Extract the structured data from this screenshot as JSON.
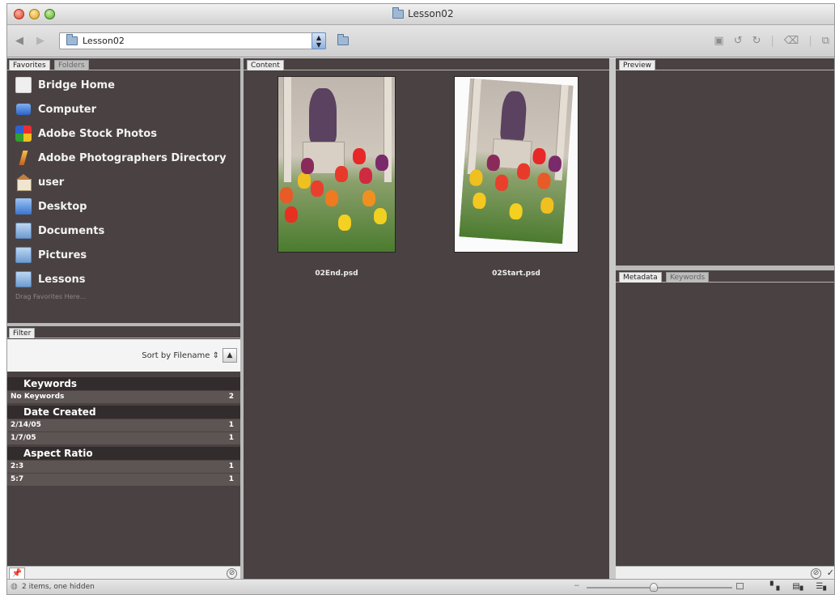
{
  "window": {
    "title": "Lesson02"
  },
  "toolbar": {
    "back_icon": "back-arrow-icon",
    "forward_icon": "forward-arrow-icon",
    "path_value": "Lesson02"
  },
  "favorites_panel": {
    "tabs": [
      "Favorites",
      "Folders"
    ],
    "items": [
      {
        "label": "Bridge Home",
        "icon": "bridge-home-icon"
      },
      {
        "label": "Computer",
        "icon": "computer-icon"
      },
      {
        "label": "Adobe Stock Photos",
        "icon": "stock-photos-icon"
      },
      {
        "label": "Adobe Photographers Directory",
        "icon": "photographers-icon"
      },
      {
        "label": "user",
        "icon": "home-icon"
      },
      {
        "label": "Desktop",
        "icon": "desktop-icon"
      },
      {
        "label": "Documents",
        "icon": "folder-icon"
      },
      {
        "label": "Pictures",
        "icon": "folder-icon"
      },
      {
        "label": "Lessons",
        "icon": "folder-icon"
      }
    ],
    "drag_hint": "Drag Favorites Here..."
  },
  "filter_panel": {
    "tab": "Filter",
    "sort_label": "Sort by Filename",
    "groups": [
      {
        "heading": "Keywords",
        "rows": [
          {
            "label": "No Keywords",
            "count": "2"
          }
        ]
      },
      {
        "heading": "Date Created",
        "rows": [
          {
            "label": "2/14/05",
            "count": "1"
          },
          {
            "label": "1/7/05",
            "count": "1"
          }
        ]
      },
      {
        "heading": "Aspect Ratio",
        "rows": [
          {
            "label": "2:3",
            "count": "1"
          },
          {
            "label": "5:7",
            "count": "1"
          }
        ]
      }
    ]
  },
  "content_panel": {
    "tab": "Content",
    "thumbnails": [
      {
        "filename": "02End.psd"
      },
      {
        "filename": "02Start.psd"
      }
    ]
  },
  "preview_panel": {
    "tab": "Preview"
  },
  "metadata_panel": {
    "tabs": [
      "Metadata",
      "Keywords"
    ]
  },
  "statusbar": {
    "text": "2 items, one hidden"
  },
  "colors": {
    "panel_bg": "#4a4242",
    "chrome": "#e8e8e8"
  }
}
